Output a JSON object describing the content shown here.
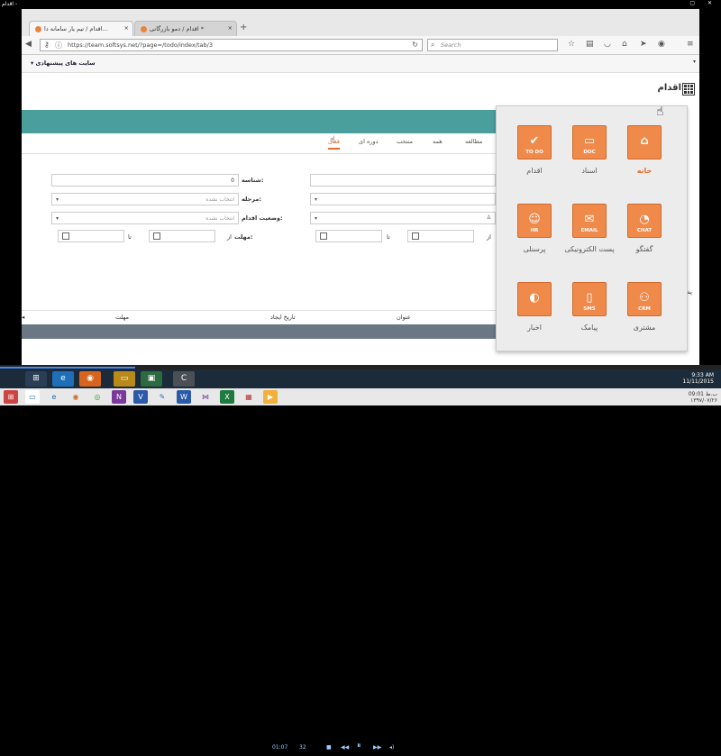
{
  "player": {
    "title": "اقدام -",
    "controls": "▢ ✕"
  },
  "browser": {
    "tabs": [
      {
        "label": "اقدام / تیم یار سامانه دا..."
      },
      {
        "label": "اقدام / دمو بازرگانی *"
      }
    ],
    "url": "https://team.softsys.net/?page=/todo/index/tab/3",
    "search_placeholder": "Search",
    "bookmark": "▾ سایت های پیشنهادی"
  },
  "page": {
    "title": "اقدام",
    "tabs": [
      "مطالعه",
      "همه",
      "منتخب",
      "دوره ای",
      "فعال"
    ],
    "form": {
      "id_label": "شناسه:",
      "id_value": "0",
      "stage_label": "مرحله:",
      "stage_value": "انتخاب نشده",
      "status_label": "وضعیت اقدام:",
      "status_value": "انتخاب نشده",
      "deadline_label": "مهلت:",
      "from_label": "از",
      "to_label": "تا"
    },
    "table_headers": [
      "عنوان",
      "تاریخ ایجاد",
      "مهلت"
    ],
    "side_item": "پشتیبانی"
  },
  "menu": {
    "tiles": [
      {
        "label": "خانه",
        "glyph": "⌂",
        "sub": ""
      },
      {
        "label": "اسناد",
        "glyph": "▭",
        "sub": "DOC"
      },
      {
        "label": "اقدام",
        "glyph": "✔",
        "sub": "TO DO"
      },
      {
        "label": "گفتگو",
        "glyph": "◔",
        "sub": "CHAT"
      },
      {
        "label": "پست الکترونیکی",
        "glyph": "✉",
        "sub": "EMAIL"
      },
      {
        "label": "پرسنلی",
        "glyph": "☺",
        "sub": "HR"
      },
      {
        "label": "مشتری",
        "glyph": "⚇",
        "sub": "CRM"
      },
      {
        "label": "پیامک",
        "glyph": "▯",
        "sub": "SMS"
      },
      {
        "label": "اخبار",
        "glyph": "◐",
        "sub": ""
      }
    ]
  },
  "media": {
    "time": "01:07",
    "volume": "32"
  },
  "clock": {
    "time": "9:33 AM",
    "date": "11/11/2015"
  },
  "bottom_clock": {
    "time": "09:01 ب.ظ",
    "date": "۱۳۹۷/۰۷/۲۶"
  },
  "colors": {
    "teal": "#4a9f9c",
    "orange": "#ef8a4b",
    "accent": "#e46b2c"
  }
}
